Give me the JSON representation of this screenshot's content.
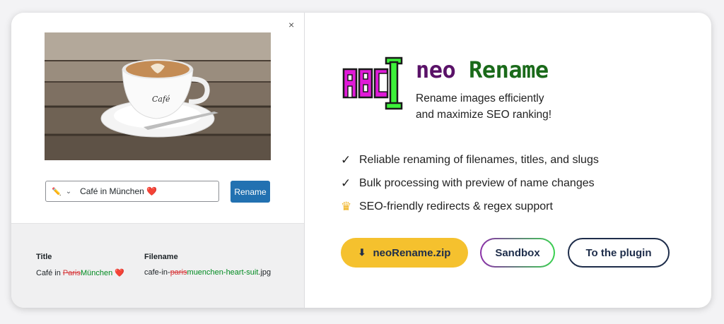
{
  "dialog": {
    "close_glyph": "×",
    "rename_field": {
      "pencil_glyph": "✏️",
      "chevron_glyph": "⌄",
      "value": "Café in München ❤️"
    },
    "rename_button": "Rename",
    "preview": {
      "title_header": "Title",
      "filename_header": "Filename",
      "title_parts": {
        "prefix": "Café in ",
        "removed": "Paris",
        "added": "München",
        "suffix": " ❤️"
      },
      "filename_parts": {
        "prefix": "cafe-in-",
        "removed": "paris",
        "added": "muenchen-heart-suit",
        "suffix": ".jpg"
      }
    }
  },
  "product": {
    "logo": {
      "text": "ABC",
      "colors": {
        "magenta": "#e01ad8",
        "green": "#3df23a"
      }
    },
    "name_part1": "neo",
    "name_part2": "Rename",
    "tagline_line1": "Rename images efficiently",
    "tagline_line2": "and maximize SEO ranking!",
    "features": [
      {
        "icon": "check-icon",
        "glyph": "✓",
        "text": "Reliable renaming of filenames, titles, and slugs"
      },
      {
        "icon": "check-icon",
        "glyph": "✓",
        "text": "Bulk processing with preview of name changes"
      },
      {
        "icon": "crown-icon",
        "glyph": "♛",
        "text": "SEO-friendly redirects & regex support"
      }
    ],
    "buttons": {
      "download_glyph": "⬇",
      "download": "neoRename.zip",
      "sandbox": "Sandbox",
      "plugin": "To the plugin"
    }
  },
  "colors": {
    "accent_blue": "#2271b1",
    "yellow": "#f5c12e",
    "navy": "#1e2d4a",
    "removed": "#d63638",
    "added": "#008a20"
  }
}
